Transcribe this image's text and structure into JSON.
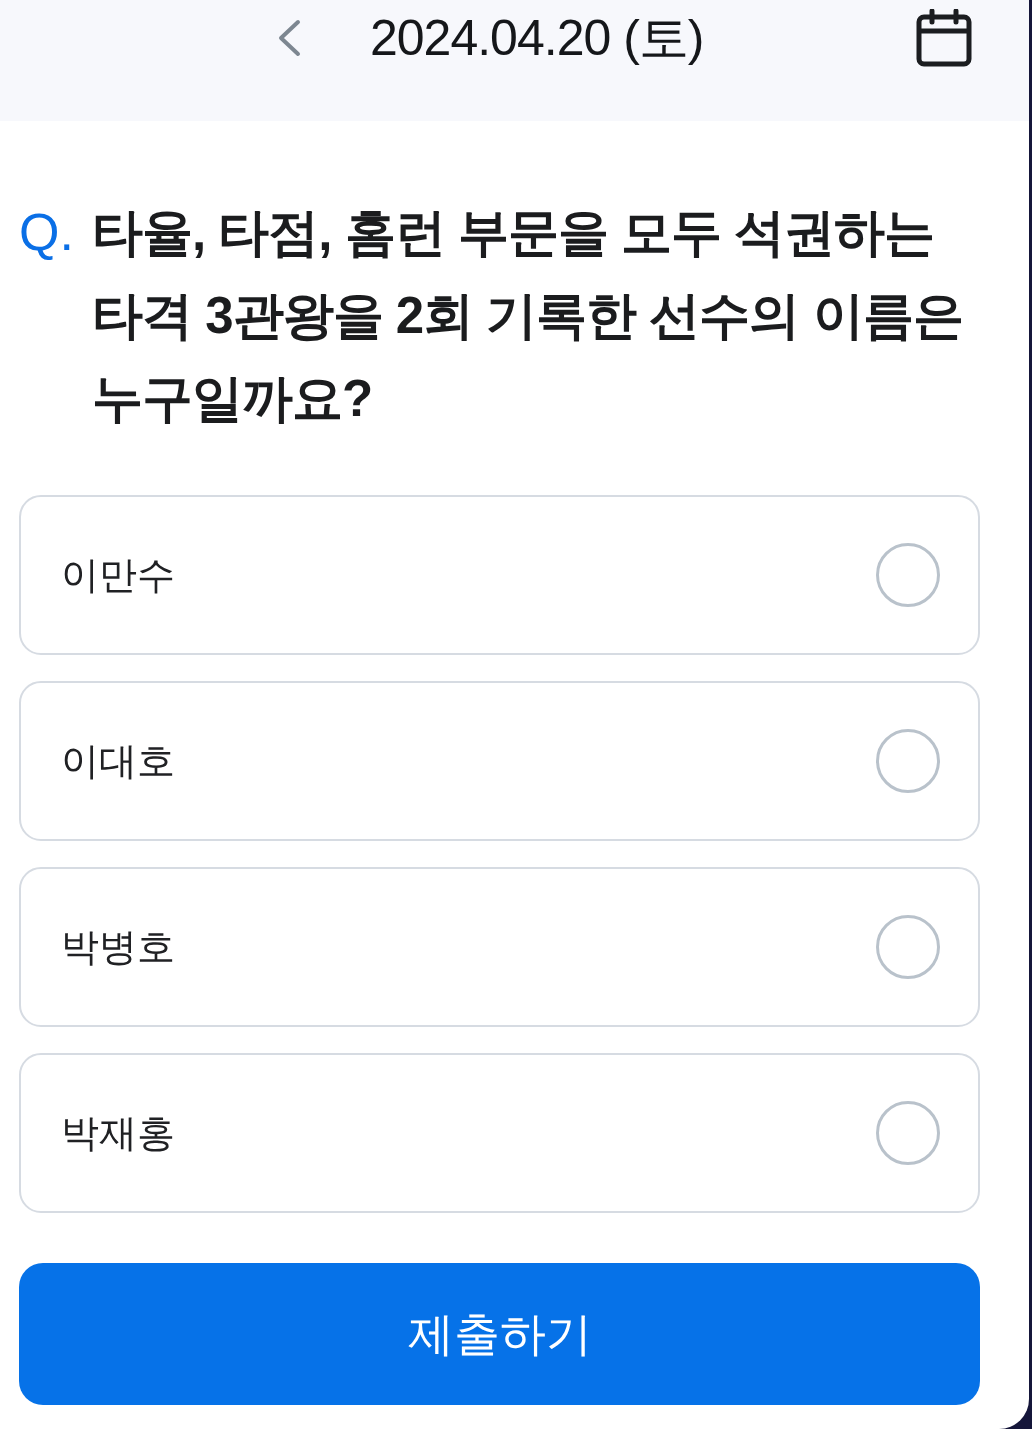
{
  "header": {
    "date": "2024.04.20 (토)"
  },
  "question": {
    "prefix": "Q.",
    "text": "타율, 타점, 홈런 부문을 모두 석권하는 타격 3관왕을 2회 기록한 선수의 이름은 누구일까요?"
  },
  "options": [
    {
      "label": "이만수",
      "selected": false
    },
    {
      "label": "이대호",
      "selected": false
    },
    {
      "label": "박병호",
      "selected": false
    },
    {
      "label": "박재홍",
      "selected": false
    }
  ],
  "submit": {
    "label": "제출하기"
  }
}
